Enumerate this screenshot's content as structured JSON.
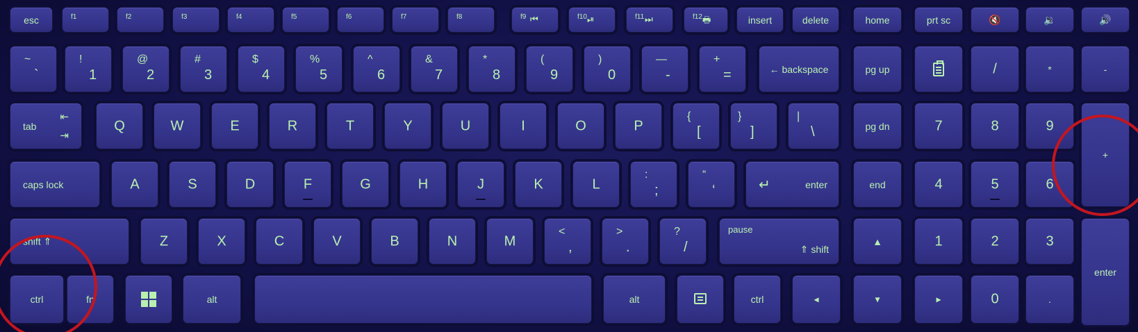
{
  "keyboard": {
    "row0": [
      {
        "main": "esc"
      },
      {
        "tl": "f1"
      },
      {
        "tl": "f2"
      },
      {
        "tl": "f3"
      },
      {
        "tl": "f4"
      },
      {
        "tl": "f5"
      },
      {
        "tl": "f6"
      },
      {
        "tl": "f7"
      },
      {
        "tl": "f8"
      },
      {
        "tl": "f9",
        "icon": "⏮"
      },
      {
        "tl": "f10",
        "icon": "⏯"
      },
      {
        "tl": "f11",
        "icon": "⏭"
      },
      {
        "tl": "f12",
        "icon": "🖶"
      },
      {
        "main": "insert"
      },
      {
        "main": "delete"
      },
      {
        "main": "home"
      },
      {
        "main": "prt sc"
      },
      {
        "icon": "🔇"
      },
      {
        "icon": "🔉"
      },
      {
        "icon": "🔊"
      }
    ],
    "row1": [
      {
        "sh": "~",
        "bs": "`"
      },
      {
        "sh": "!",
        "bs": "1"
      },
      {
        "sh": "@",
        "bs": "2"
      },
      {
        "sh": "#",
        "bs": "3"
      },
      {
        "sh": "$",
        "bs": "4"
      },
      {
        "sh": "%",
        "bs": "5"
      },
      {
        "sh": "^",
        "bs": "6"
      },
      {
        "sh": "&",
        "bs": "7"
      },
      {
        "sh": "*",
        "bs": "8"
      },
      {
        "sh": "(",
        "bs": "9"
      },
      {
        "sh": ")",
        "bs": "0"
      },
      {
        "sh": "—",
        "bs": "-"
      },
      {
        "sh": "+",
        "bs": "="
      },
      {
        "main": "← backspace"
      },
      {
        "main": "pg up"
      },
      {
        "main": "/"
      },
      {
        "main": "*"
      },
      {
        "main": "-"
      }
    ],
    "row2": [
      "tab",
      "Q",
      "W",
      "E",
      "R",
      "T",
      "Y",
      "U",
      "I",
      "O",
      "P",
      "{",
      "[",
      "}",
      "]",
      "|",
      "\\",
      "pg dn",
      "7",
      "8",
      "9",
      "+"
    ],
    "tab_icons": [
      "⇤",
      "⇥"
    ],
    "row3": [
      "caps lock",
      "A",
      "S",
      "D",
      "F",
      "G",
      "H",
      "J",
      "K",
      "L",
      ":",
      ";",
      "“",
      "‘",
      "↵",
      "enter",
      "end",
      "4",
      "5",
      "6"
    ],
    "row4": [
      "shift ⇑",
      "Z",
      "X",
      "C",
      "V",
      "B",
      "N",
      "M",
      "<",
      ",",
      ">",
      ".",
      "?",
      "/",
      "pause",
      "⇑ shift",
      "▲",
      "1",
      "2",
      "3",
      "enter"
    ],
    "row5": [
      "ctrl",
      "fn",
      "alt",
      "",
      "alt",
      "ctrl",
      "◂",
      "▾",
      "▸",
      "0",
      "."
    ]
  }
}
